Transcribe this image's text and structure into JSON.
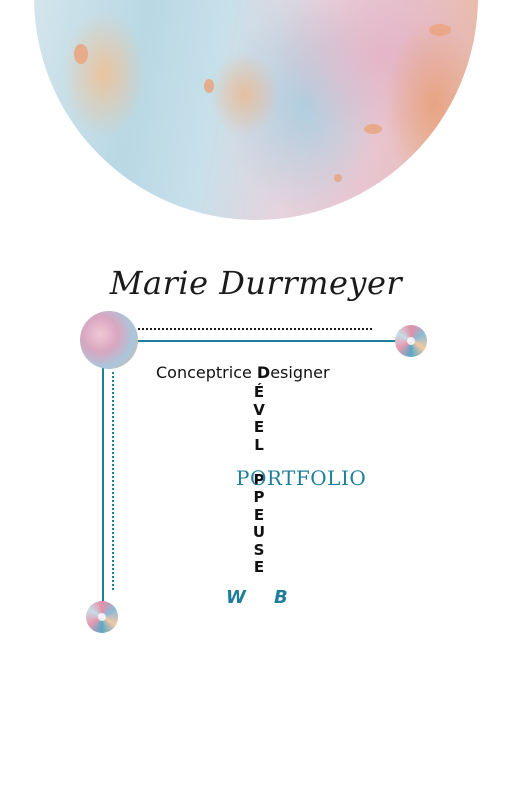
{
  "header": {
    "name": "Marie Durrmeyer"
  },
  "role": {
    "prefix": "Conceptrice ",
    "designer_initial": "D",
    "designer_rest": "esigner"
  },
  "vertical_word": {
    "letters": [
      "É",
      "V",
      "E",
      "L",
      "O",
      "P",
      "P",
      "E",
      "U",
      "S",
      "E"
    ]
  },
  "portfolio_label": "PORTFOLIO",
  "web": {
    "w": "W",
    "b": "B"
  },
  "colors": {
    "accent": "#1f7f9a",
    "text": "#111111"
  },
  "icons": {
    "hero": "abstract-paint-circle",
    "orb_large": "paint-orb",
    "orb_small": "paint-burst-orb"
  }
}
